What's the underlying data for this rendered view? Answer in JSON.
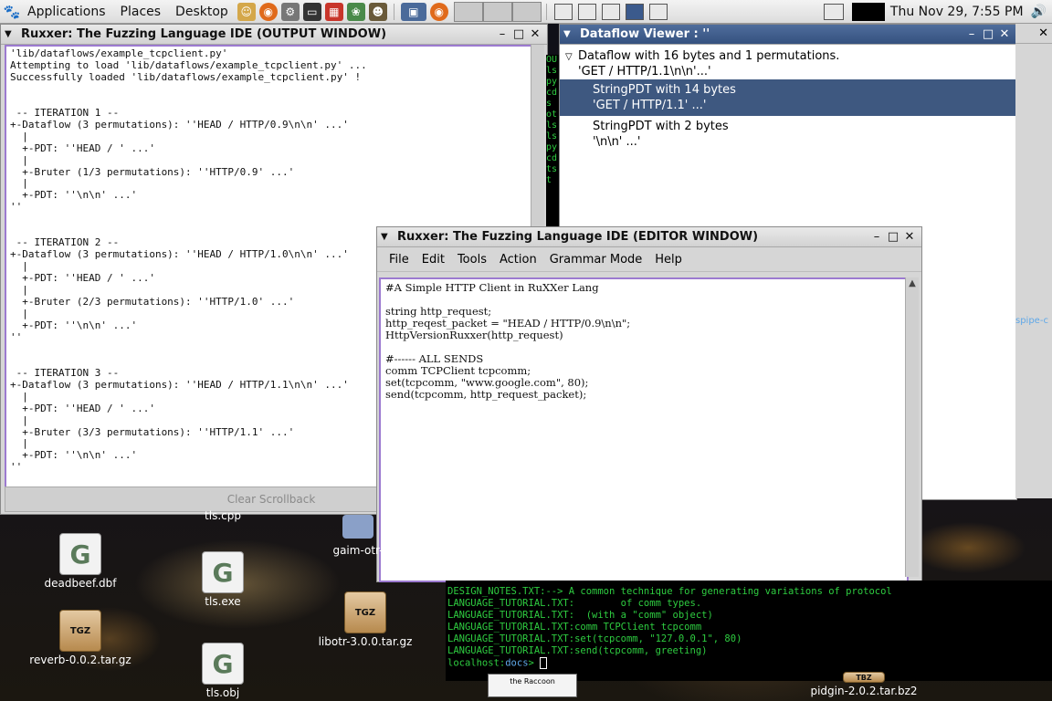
{
  "panel": {
    "menus": [
      "Applications",
      "Places",
      "Desktop"
    ],
    "clock": "Thu Nov 29,  7:55 PM"
  },
  "output_window": {
    "title": "Ruxxer: The Fuzzing Language IDE (OUTPUT WINDOW)",
    "text": "'lib/dataflows/example_tcpclient.py'\nAttempting to load 'lib/dataflows/example_tcpclient.py' ...\nSuccessfully loaded 'lib/dataflows/example_tcpclient.py' !\n\n\n -- ITERATION 1 --\n+-Dataflow (3 permutations): ''HEAD / HTTP/0.9\\n\\n' ...'\n  |\n  +-PDT: ''HEAD / ' ...'\n  |\n  +-Bruter (1/3 permutations): ''HTTP/0.9' ...'\n  |\n  +-PDT: ''\\n\\n' ...'\n''\n\n\n -- ITERATION 2 --\n+-Dataflow (3 permutations): ''HEAD / HTTP/1.0\\n\\n' ...'\n  |\n  +-PDT: ''HEAD / ' ...'\n  |\n  +-Bruter (2/3 permutations): ''HTTP/1.0' ...'\n  |\n  +-PDT: ''\\n\\n' ...'\n''\n\n\n -- ITERATION 3 --\n+-Dataflow (3 permutations): ''HEAD / HTTP/1.1\\n\\n' ...'\n  |\n  +-PDT: ''HEAD / ' ...'\n  |\n  +-Bruter (3/3 permutations): ''HTTP/1.1' ...'\n  |\n  +-PDT: ''\\n\\n' ...'\n''",
    "clear_button": "Clear Scrollback"
  },
  "dataflow_viewer": {
    "title": "Dataflow Viewer :  ''",
    "root": {
      "line1": "Dataflow with 16 bytes and 1 permutations.",
      "line2": "'GET / HTTP/1.1\\n\\n'...'"
    },
    "children": [
      {
        "line1": "StringPDT with 14 bytes",
        "line2": "'GET / HTTP/1.1' ...'"
      },
      {
        "line1": "StringPDT with 2 bytes",
        "line2": "'\\n\\n' ...'"
      }
    ]
  },
  "editor_window": {
    "title": "Ruxxer: The Fuzzing Language IDE (EDITOR WINDOW)",
    "menus": [
      "File",
      "Edit",
      "Tools",
      "Action",
      "Grammar Mode",
      "Help"
    ],
    "code": "#A Simple HTTP Client in RuXXer Lang\n\nstring http_request;\nhttp_reqest_packet = \"HEAD / HTTP/0.9\\n\\n\";\nHttpVersionRuxxer(http_request)\n\n#------ ALL SENDS\ncomm TCPClient tcpcomm;\nset(tcpcomm, \"www.google.com\", 80);\nsend(tcpcomm, http_request_packet);"
  },
  "terminal": {
    "lines": [
      "DESIGN_NOTES.TXT:--> A common technique for generating variations of protocol",
      "LANGUAGE_TUTORIAL.TXT:        of comm types.",
      "LANGUAGE_TUTORIAL.TXT:  (with a \"comm\" object)",
      "LANGUAGE_TUTORIAL.TXT:comm TCPClient tcpcomm",
      "LANGUAGE_TUTORIAL.TXT:set(tcpcomm, \"127.0.0.1\", 80)",
      "LANGUAGE_TUTORIAL.TXT:send(tcpcomm, greeting)"
    ],
    "prompt_host": "localhost",
    "prompt_dir": "docs"
  },
  "desktop_icons": [
    {
      "label": "deadbeef.dbf",
      "kind": "gnome-file"
    },
    {
      "label": "reverb-0.0.2.tar.gz",
      "kind": "tgz"
    },
    {
      "label": "tls.cpp",
      "kind": "gnome-file"
    },
    {
      "label": "tls.exe",
      "kind": "gnome-file"
    },
    {
      "label": "tls.obj",
      "kind": "gnome-file"
    },
    {
      "label": "gaim-otr-",
      "kind": "file"
    },
    {
      "label": "libotr-3.0.0.tar.gz",
      "kind": "tgz"
    },
    {
      "label": "pidgin-2.0.2.tar.bz2",
      "kind": "tgz"
    }
  ],
  "bg_terminal_strip": [
    "OU",
    "ls",
    "py",
    "cd",
    "s",
    "ot",
    "ls",
    "ls",
    "py",
    "cd",
    "ts",
    "t"
  ],
  "right_strip_text": "spipe-c",
  "raccoon_text": "the Raccoon",
  "colors": {
    "selection": "#3e5880",
    "editor_border": "#9c7ad0",
    "terminal_text": "#2ecc40"
  }
}
